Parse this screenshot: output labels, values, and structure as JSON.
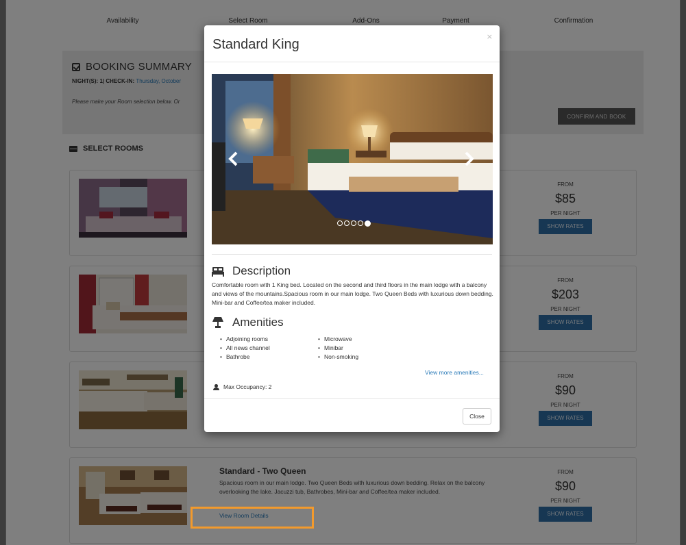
{
  "steps": [
    "Availability",
    "Select Room",
    "Add-Ons",
    "Payment",
    "Confirmation"
  ],
  "summary": {
    "title": "BOOKING SUMMARY",
    "meta_label": "NIGHT(S): 1| CHECK-IN:",
    "meta_value": "Thursday, October",
    "note": "Please make your Room selection below. Or",
    "confirm_label": "CONFIRM AND BOOK"
  },
  "select_rooms_title": "SELECT ROOMS",
  "rooms": [
    {
      "from": "FROM",
      "price": "$85",
      "per": "PER NIGHT",
      "button": "SHOW RATES"
    },
    {
      "from": "FROM",
      "price": "$203",
      "per": "PER NIGHT",
      "button": "SHOW RATES"
    },
    {
      "from": "FROM",
      "price": "$90",
      "per": "PER NIGHT",
      "button": "SHOW RATES"
    },
    {
      "from": "FROM",
      "price": "$90",
      "per": "PER NIGHT",
      "button": "SHOW RATES",
      "name": "Standard - Two Queen",
      "description": "Spacious room in our main lodge. Two Queen Beds with luxurious down bedding. Relax on the balcony overlooking the lake. Jacuzzi tub, Bathrobes, Mini-bar and Coffee/tea maker included.",
      "link": "View Room Details"
    }
  ],
  "modal": {
    "title": "Standard King",
    "close_x": "×",
    "description_title": "Description",
    "description": "Comfortable room with 1 King bed. Located on the second and third floors in the main lodge with a balcony and views of the mountains.Spacious room in our main lodge. Two Queen Beds with luxurious down bedding. Mini-bar and Coffee/tea maker included.",
    "amenities_title": "Amenities",
    "amenities_col1": [
      "Adjoining rooms",
      "All news channel",
      "Bathrobe"
    ],
    "amenities_col2": [
      "Microwave",
      "Minibar",
      "Non-smoking"
    ],
    "more_amenities": "View more amenities...",
    "occupancy": "Max Occupancy: 2",
    "close_label": "Close",
    "carousel": {
      "slides": 4,
      "active": 4
    }
  },
  "colors": {
    "primary_button": "#2e6fa7",
    "link": "#2a7ab8",
    "highlight": "#f39a2c"
  }
}
